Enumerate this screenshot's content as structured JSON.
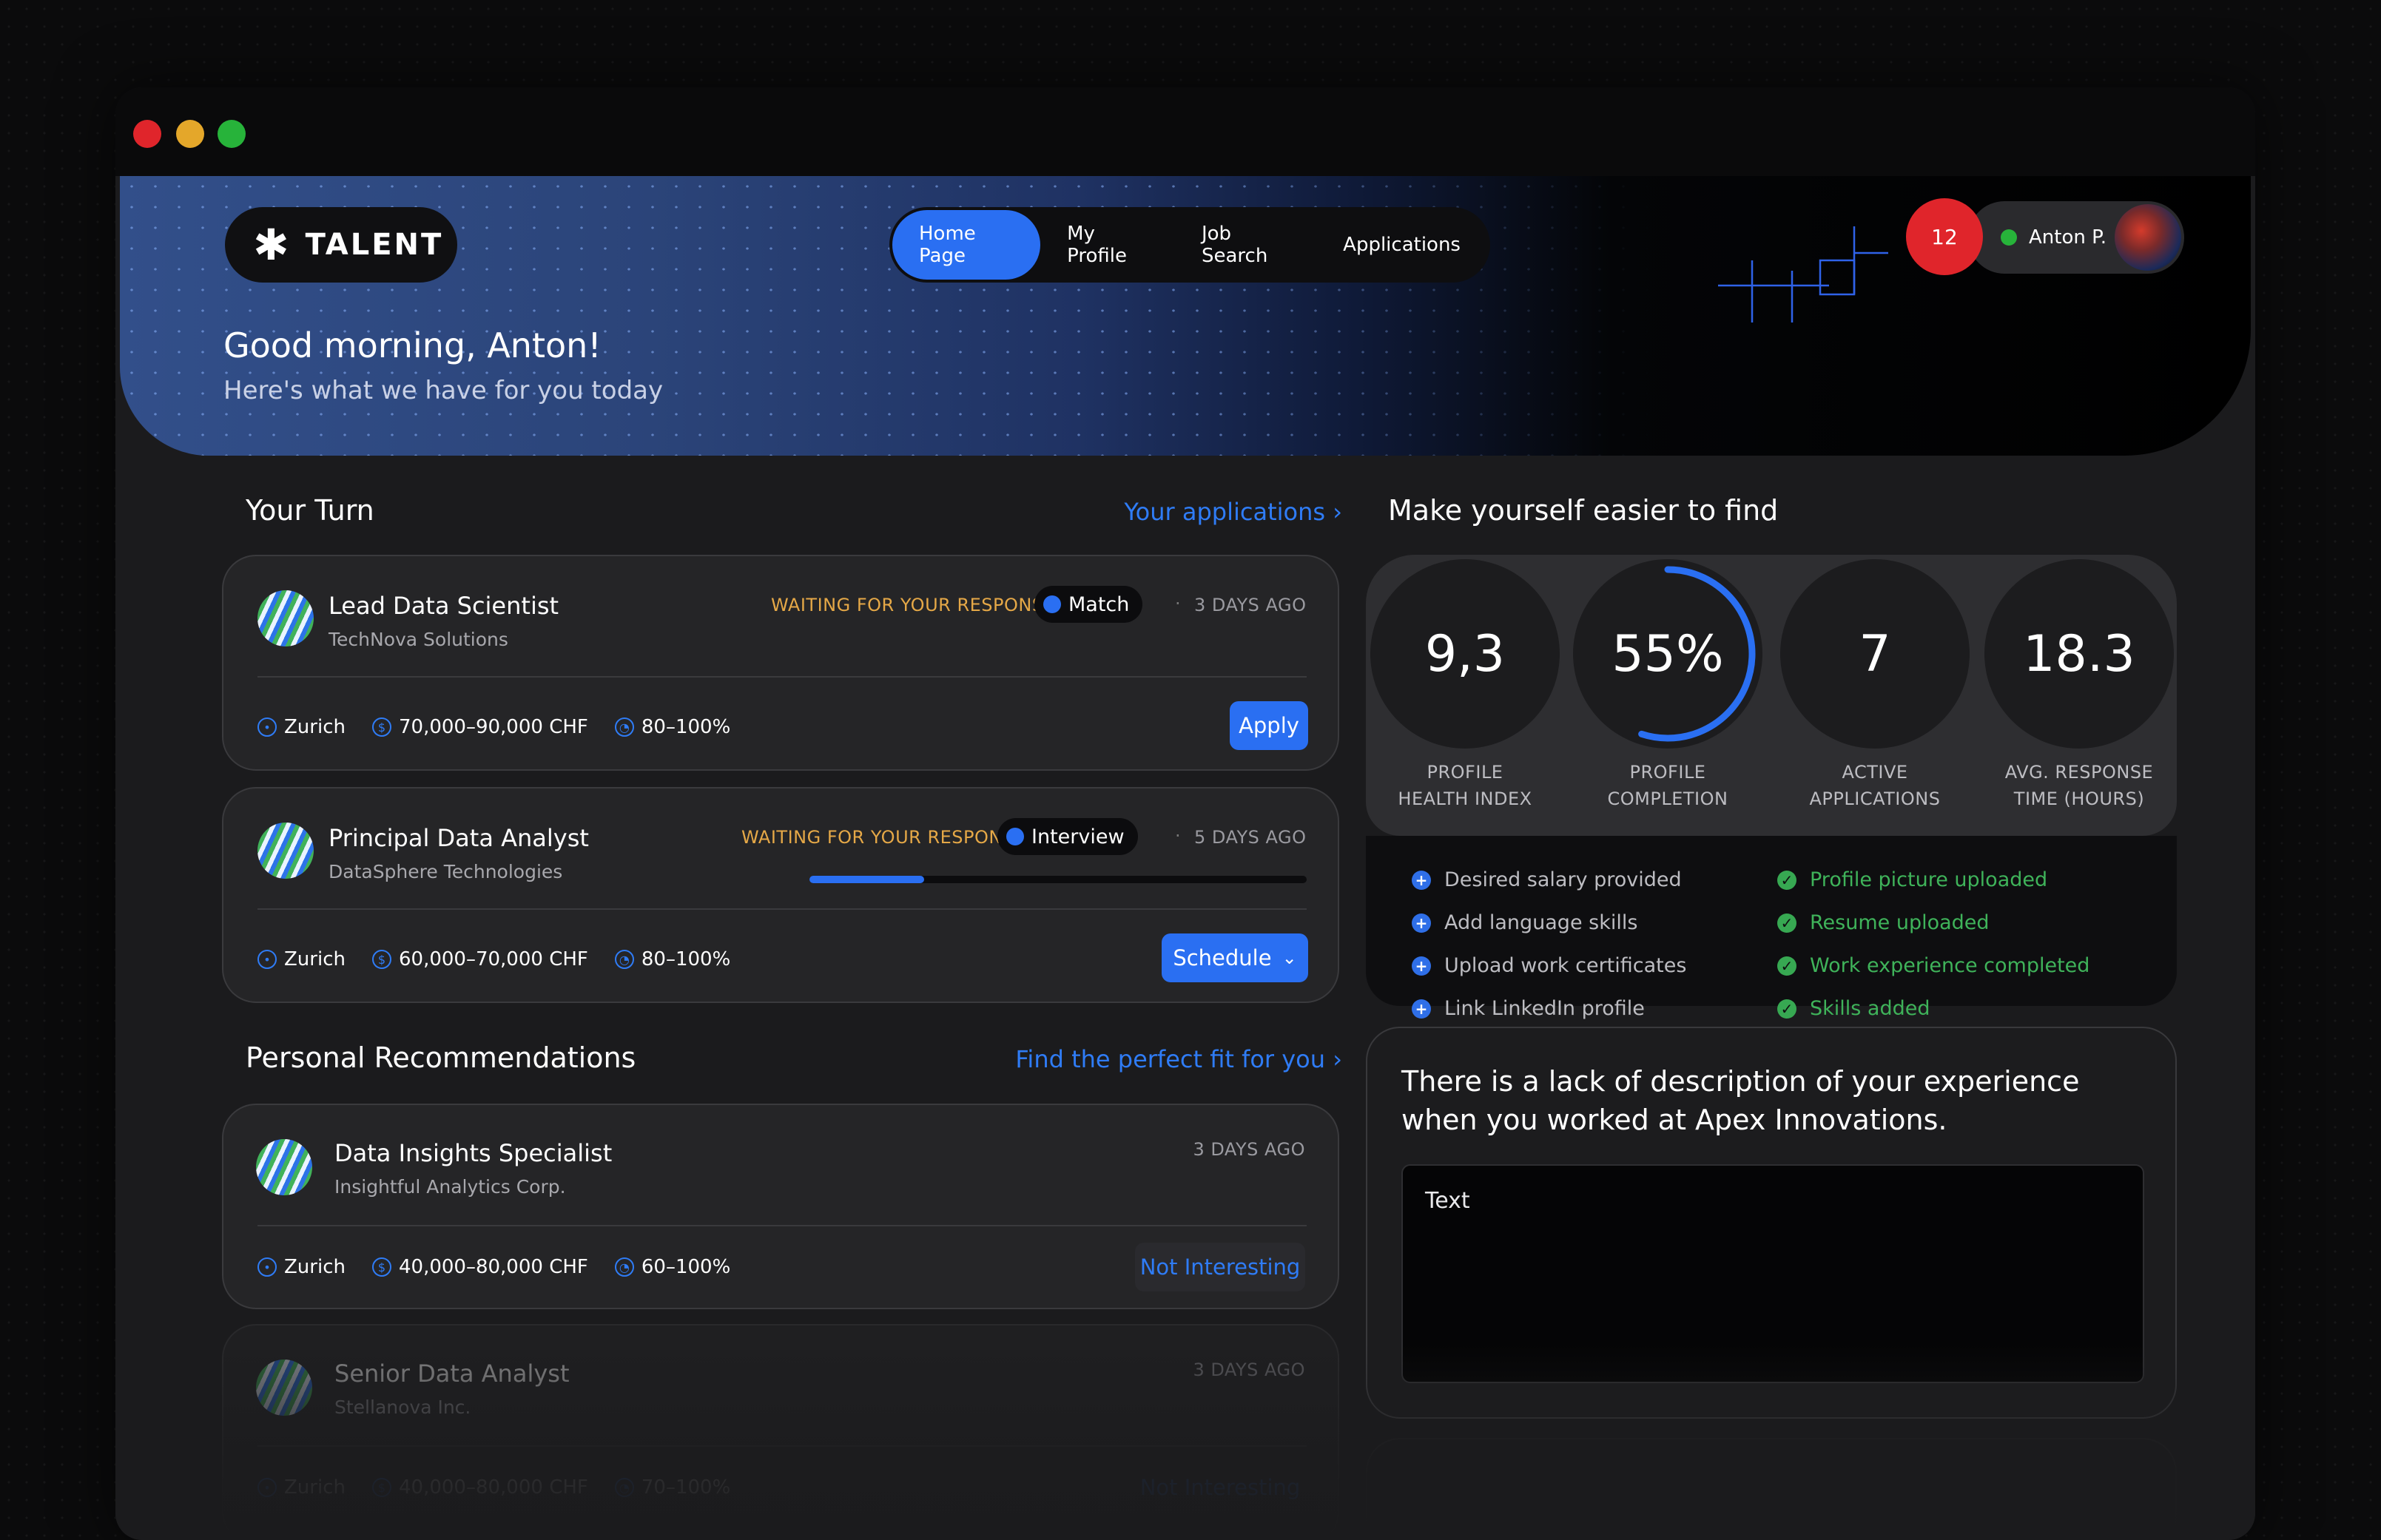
{
  "brand": {
    "name": "TALENT"
  },
  "nav": {
    "items": [
      {
        "label": "Home Page",
        "active": true
      },
      {
        "label": "My Profile"
      },
      {
        "label": "Job Search"
      },
      {
        "label": "Applications"
      }
    ]
  },
  "header": {
    "notifications": "12",
    "user_name": "Anton P.",
    "greeting": "Good morning, Anton!",
    "subtitle": "Here's what we have for you today"
  },
  "your_turn": {
    "title": "Your Turn",
    "link": "Your applications ›",
    "cards": [
      {
        "title": "Lead Data Scientist",
        "company": "TechNova Solutions",
        "status": "WAITING FOR YOUR RESPONSE",
        "badge": "Match",
        "date": "3 DAYS AGO",
        "location": "Zurich",
        "salary": "70,000–90,000 CHF",
        "workload": "80–100%",
        "action": "Apply"
      },
      {
        "title": "Principal Data Analyst",
        "company": "DataSphere Technologies",
        "status": "WAITING FOR YOUR RESPONSE",
        "badge": "Interview",
        "date": "5 DAYS AGO",
        "progress": 0.23,
        "location": "Zurich",
        "salary": "60,000–70,000 CHF",
        "workload": "80–100%",
        "action": "Schedule"
      }
    ]
  },
  "recommendations": {
    "title": "Personal Recommendations",
    "link": "Find the perfect fit for you ›",
    "cards": [
      {
        "title": "Data Insights Specialist",
        "company": "Insightful Analytics Corp.",
        "date": "3 DAYS AGO",
        "location": "Zurich",
        "salary": "40,000–80,000 CHF",
        "workload": "60–100%",
        "action": "Not Interesting"
      },
      {
        "title": "Senior Data Analyst",
        "company": "Stellanova Inc.",
        "date": "3 DAYS AGO",
        "location": "Zurich",
        "salary": "40,000–80,000 CHF",
        "workload": "70–100%",
        "action": "Not Interesting"
      }
    ]
  },
  "profile": {
    "title": "Make yourself easier to find",
    "stats": [
      {
        "value": "9,3",
        "label_1": "PROFILE",
        "label_2": "HEALTH INDEX"
      },
      {
        "value": "55%",
        "label_1": "PROFILE",
        "label_2": "COMPLETION",
        "ring": 0.55
      },
      {
        "value": "7",
        "label_1": "ACTIVE",
        "label_2": "APPLICATIONS"
      },
      {
        "value": "18.3",
        "label_1": "AVG. RESPONSE",
        "label_2": "TIME (HOURS)"
      }
    ],
    "todo": [
      "Desired salary provided",
      "Add language skills",
      "Upload work certificates",
      "Link LinkedIn profile"
    ],
    "done": [
      "Profile picture uploaded",
      "Resume uploaded",
      "Work experience completed",
      "Skills added"
    ]
  },
  "experience_prompt": {
    "question": "There is a lack of description of your experience when you worked at Apex Innovations.",
    "text": "Text"
  },
  "colors": {
    "accent": "#2a6ff2",
    "warning": "#e5a847",
    "success": "#3fb35a",
    "danger": "#e0252b"
  },
  "icons": {
    "logo": "asterisk-icon",
    "location": "location-pin-icon",
    "salary": "coin-icon",
    "workload": "pie-clock-icon",
    "todo": "plus-circle-icon",
    "done": "check-circle-icon"
  }
}
